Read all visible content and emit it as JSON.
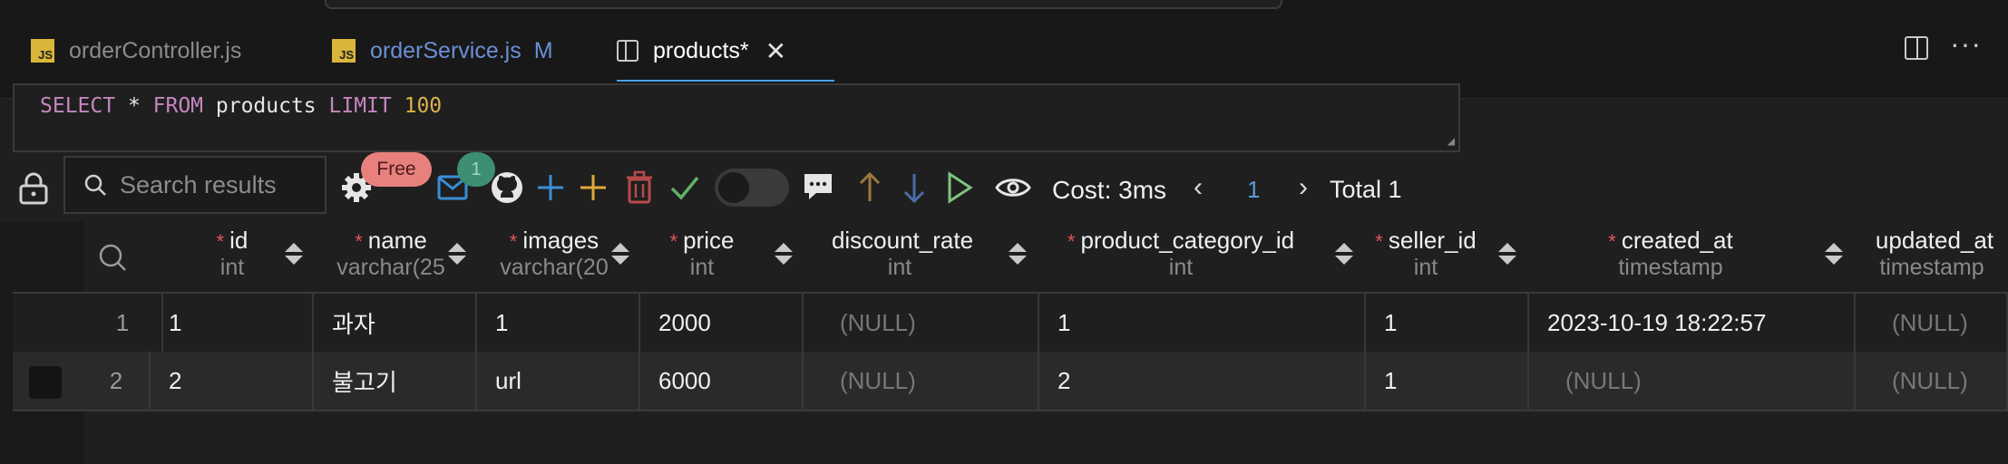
{
  "tabs": [
    {
      "label": "orderController.js",
      "icon": "js-file-icon",
      "badge": "JS"
    },
    {
      "label": "orderService.js",
      "icon": "js-file-icon",
      "badge": "JS",
      "status": "M"
    },
    {
      "label": "products*",
      "icon": "table-split-icon",
      "active": true
    }
  ],
  "editor": {
    "kw_select": "SELECT",
    "star": " * ",
    "kw_from": "FROM",
    "table": " products ",
    "kw_limit": "LIMIT",
    "limit_value": " 100"
  },
  "toolbar": {
    "search_placeholder": "Search results",
    "free_badge": "Free",
    "count_badge": "1",
    "cost": "Cost: 3ms",
    "page": "1",
    "total": "Total 1"
  },
  "columns": [
    {
      "name": "id",
      "type": "int",
      "required": "*"
    },
    {
      "name": "name",
      "type": "varchar(25",
      "required": "*"
    },
    {
      "name": "images",
      "type": "varchar(20",
      "required": "*"
    },
    {
      "name": "price",
      "type": "int",
      "required": "*"
    },
    {
      "name": "discount_rate",
      "type": "int",
      "required": ""
    },
    {
      "name": "product_category_id",
      "type": "int",
      "required": "*"
    },
    {
      "name": "seller_id",
      "type": "int",
      "required": "*"
    },
    {
      "name": "created_at",
      "type": "timestamp",
      "required": "*"
    },
    {
      "name": "updated_at",
      "type": "timestamp",
      "required": ""
    }
  ],
  "rows": [
    {
      "num": "1",
      "cells": [
        "1",
        "과자",
        "1",
        "2000",
        "(NULL)",
        "1",
        "1",
        "2023-10-19 18:22:57",
        "(NULL)"
      ]
    },
    {
      "num": "2",
      "cells": [
        "2",
        "불고기",
        "url",
        "6000",
        "(NULL)",
        "2",
        "1",
        "(NULL)",
        "(NULL)"
      ]
    }
  ],
  "colors": {
    "accent": "#4da3e8",
    "keyword": "#c586c0",
    "number": "#dcb24a",
    "required": "#e05555",
    "null_text": "#777777"
  }
}
